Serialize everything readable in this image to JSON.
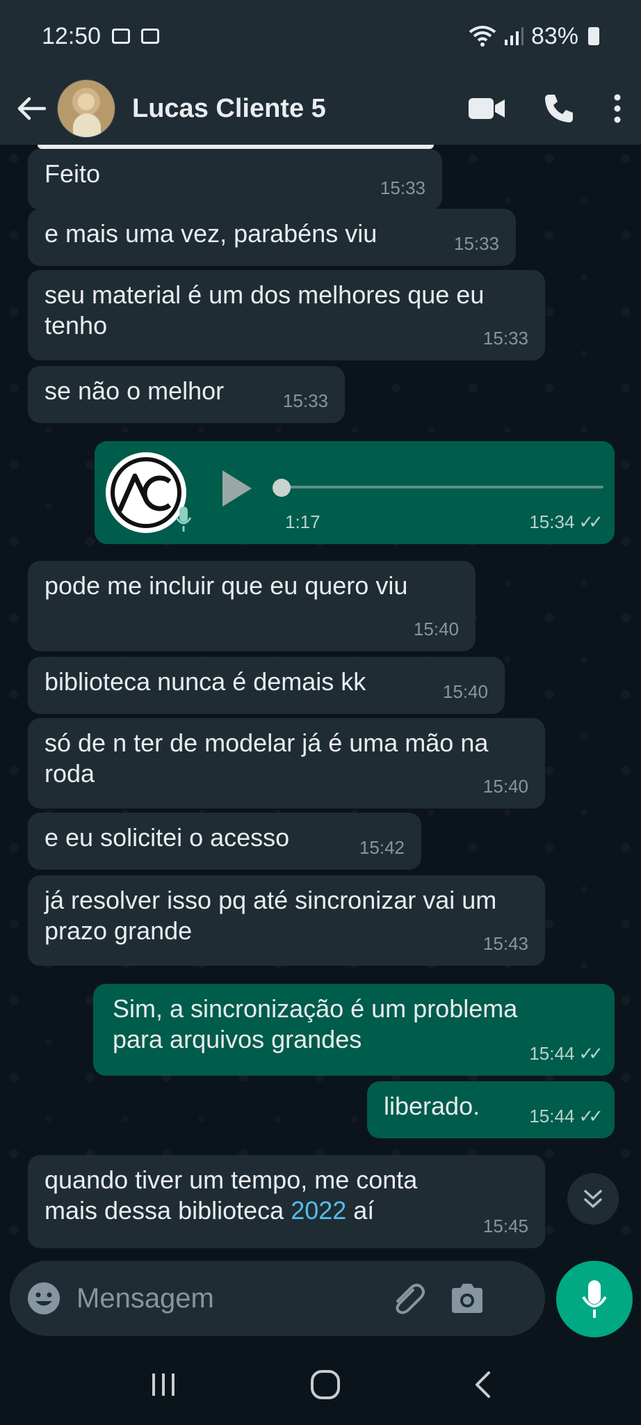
{
  "status_bar": {
    "time": "12:50",
    "battery": "83%"
  },
  "header": {
    "contact_name": "Lucas Cliente 5"
  },
  "messages": [
    {
      "text": "Feito",
      "time": "15:33"
    },
    {
      "text": "e mais uma vez, parabéns viu",
      "time": "15:33"
    },
    {
      "text": "seu material é um dos melhores que eu tenho",
      "time": "15:33"
    },
    {
      "text": "se não o melhor",
      "time": "15:33"
    },
    {
      "duration": "1:17",
      "time": "15:34",
      "avatar_text": "AC"
    },
    {
      "text": "pode me incluir que eu quero viu",
      "time": "15:40"
    },
    {
      "text": "biblioteca nunca é demais kk",
      "time": "15:40"
    },
    {
      "text": "só de n ter de modelar  já é uma mão na roda",
      "time": "15:40"
    },
    {
      "text": "e eu solicitei o acesso",
      "time": "15:42"
    },
    {
      "text": "já resolver isso pq até sincronizar vai um prazo grande",
      "time": "15:43"
    },
    {
      "text": "Sim, a sincronização é um problema para arquivos grandes",
      "time": "15:44"
    },
    {
      "text": "liberado.",
      "time": "15:44"
    },
    {
      "text_before": "quando tiver um tempo, me conta mais dessa biblioteca ",
      "link": "2022",
      "text_after": " aí",
      "time": "15:45"
    }
  ],
  "input": {
    "placeholder": "Mensagem"
  },
  "colors": {
    "incoming": "#202c33",
    "outgoing": "#005c4b",
    "accent": "#00a884",
    "background": "#0b141a"
  }
}
